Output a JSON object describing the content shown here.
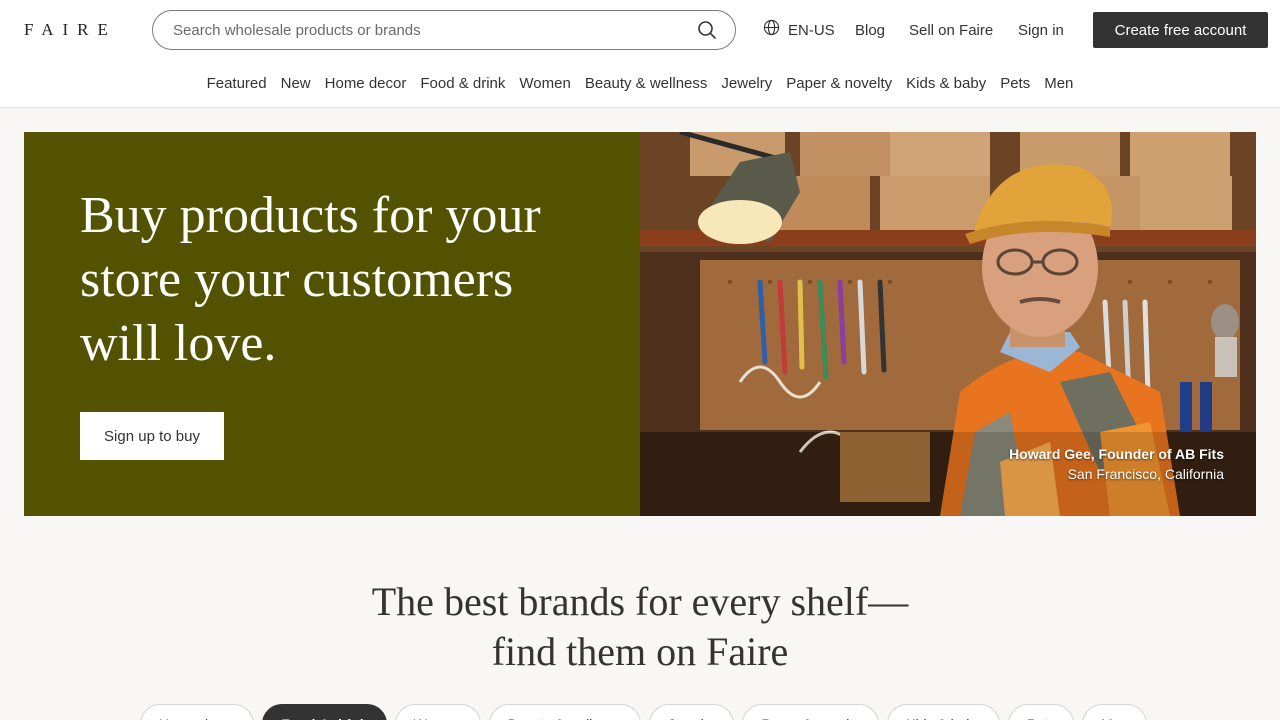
{
  "header": {
    "logo": "FAIRE",
    "search": {
      "placeholder": "Search wholesale products or brands",
      "value": ""
    },
    "language": "EN-US",
    "links": {
      "blog": "Blog",
      "sell": "Sell on Faire",
      "signin": "Sign in"
    },
    "cta": "Create free account"
  },
  "categories": [
    "Featured",
    "New",
    "Home decor",
    "Food & drink",
    "Women",
    "Beauty & wellness",
    "Jewelry",
    "Paper & novelty",
    "Kids & baby",
    "Pets",
    "Men"
  ],
  "hero": {
    "title": "Buy products for your store your customers will love.",
    "button": "Sign up to buy",
    "caption": {
      "name": "Howard Gee, Founder of AB Fits",
      "location": "San Francisco, California"
    },
    "colors": {
      "panel": "#525200"
    }
  },
  "section": {
    "title_line1": "The best brands for every shelf—",
    "title_line2": "find them on Faire",
    "pills": [
      {
        "label": "Home decor",
        "active": false
      },
      {
        "label": "Food & drink",
        "active": true
      },
      {
        "label": "Women",
        "active": false
      },
      {
        "label": "Beauty & wellness",
        "active": false
      },
      {
        "label": "Jewelry",
        "active": false
      },
      {
        "label": "Paper & novelty",
        "active": false
      },
      {
        "label": "Kids & baby",
        "active": false
      },
      {
        "label": "Pets",
        "active": false
      },
      {
        "label": "Men",
        "active": false
      }
    ]
  },
  "icons": {
    "search": "search-icon",
    "language": "globe-icon"
  }
}
